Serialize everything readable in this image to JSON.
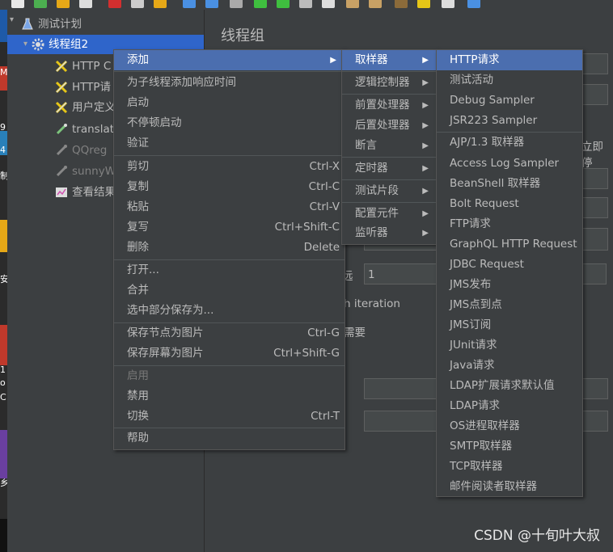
{
  "toolbar": {
    "icons": [
      {
        "name": "new-icon",
        "color": "#e8e8e8"
      },
      {
        "name": "templates-icon",
        "color": "#4caf50"
      },
      {
        "name": "open-icon",
        "color": "#e6a817"
      },
      {
        "name": "save-icon",
        "color": "#dddddd"
      },
      {
        "name": "cut-icon",
        "color": "#d32f2f"
      },
      {
        "name": "copy-icon",
        "color": "#cccccc"
      },
      {
        "name": "paste-icon",
        "color": "#e6a817"
      },
      {
        "name": "expand-icon",
        "color": "#4a90e2"
      },
      {
        "name": "collapse-icon",
        "color": "#4a90e2"
      },
      {
        "name": "toggle-icon",
        "color": "#aaaaaa"
      },
      {
        "name": "start-icon",
        "color": "#3fbf3f"
      },
      {
        "name": "start-no-pause-icon",
        "color": "#3fbf3f"
      },
      {
        "name": "stop-icon",
        "color": "#bbbbbb"
      },
      {
        "name": "shutdown-icon",
        "color": "#dddddd"
      },
      {
        "name": "clear-icon",
        "color": "#c8a165"
      },
      {
        "name": "clear-all-icon",
        "color": "#c8a165"
      },
      {
        "name": "search-icon",
        "color": "#8b6b3a"
      },
      {
        "name": "reset-search-icon",
        "color": "#e6c617"
      },
      {
        "name": "function-helper-icon",
        "color": "#dddddd"
      },
      {
        "name": "help-icon",
        "color": "#4a90e2"
      }
    ]
  },
  "desktop_strip": {
    "chars": [
      "M",
      "9",
      "4",
      "制",
      "安",
      "1",
      "o",
      "C",
      "乡"
    ]
  },
  "tree": {
    "items": [
      {
        "label": "测试计划",
        "icon": "test-plan-icon"
      },
      {
        "label": "线程组2",
        "icon": "gear-icon"
      },
      {
        "label": "HTTP C",
        "icon": "http-sampler-icon"
      },
      {
        "label": "HTTP请",
        "icon": "http-sampler-icon"
      },
      {
        "label": "用户定义",
        "icon": "user-defined-icon"
      },
      {
        "label": "translat",
        "icon": "pipette-icon"
      },
      {
        "label": "QQreg",
        "icon": "pipette-icon"
      },
      {
        "label": "sunnyW",
        "icon": "pipette-icon"
      },
      {
        "label": "查看结果",
        "icon": "results-tree-icon"
      }
    ]
  },
  "right_panel": {
    "title": "线程组",
    "partial_text_1": "立即停",
    "partial_text_2": "远",
    "loop_value": "1",
    "partial_text_3": "h iteration",
    "partial_text_4": "需要"
  },
  "context_menu": {
    "items": [
      {
        "label": "添加",
        "shortcut": "",
        "submenu": true
      },
      {
        "label": "为子线程添加响应时间",
        "shortcut": ""
      },
      {
        "label": "启动",
        "shortcut": ""
      },
      {
        "label": "不停顿启动",
        "shortcut": ""
      },
      {
        "label": "验证",
        "shortcut": ""
      },
      {
        "label": "剪切",
        "shortcut": "Ctrl-X"
      },
      {
        "label": "复制",
        "shortcut": "Ctrl-C"
      },
      {
        "label": "粘贴",
        "shortcut": "Ctrl-V"
      },
      {
        "label": "复写",
        "shortcut": "Ctrl+Shift-C"
      },
      {
        "label": "删除",
        "shortcut": "Delete"
      },
      {
        "label": "打开...",
        "shortcut": ""
      },
      {
        "label": "合并",
        "shortcut": ""
      },
      {
        "label": "选中部分保存为...",
        "shortcut": ""
      },
      {
        "label": "保存节点为图片",
        "shortcut": "Ctrl-G"
      },
      {
        "label": "保存屏幕为图片",
        "shortcut": "Ctrl+Shift-G"
      },
      {
        "label": "启用",
        "shortcut": ""
      },
      {
        "label": "禁用",
        "shortcut": ""
      },
      {
        "label": "切换",
        "shortcut": "Ctrl-T"
      },
      {
        "label": "帮助",
        "shortcut": ""
      }
    ]
  },
  "add_submenu": {
    "items": [
      {
        "label": "取样器"
      },
      {
        "label": "逻辑控制器"
      },
      {
        "label": "前置处理器"
      },
      {
        "label": "后置处理器"
      },
      {
        "label": "断言"
      },
      {
        "label": "定时器"
      },
      {
        "label": "测试片段"
      },
      {
        "label": "配置元件"
      },
      {
        "label": "监听器"
      }
    ]
  },
  "sampler_submenu": {
    "items": [
      {
        "label": "HTTP请求"
      },
      {
        "label": "测试活动"
      },
      {
        "label": "Debug Sampler"
      },
      {
        "label": "JSR223 Sampler"
      },
      {
        "label": "AJP/1.3 取样器"
      },
      {
        "label": "Access Log Sampler"
      },
      {
        "label": "BeanShell 取样器"
      },
      {
        "label": "Bolt Request"
      },
      {
        "label": "FTP请求"
      },
      {
        "label": "GraphQL HTTP Request"
      },
      {
        "label": "JDBC Request"
      },
      {
        "label": "JMS发布"
      },
      {
        "label": "JMS点到点"
      },
      {
        "label": "JMS订阅"
      },
      {
        "label": "JUnit请求"
      },
      {
        "label": "Java请求"
      },
      {
        "label": "LDAP扩展请求默认值"
      },
      {
        "label": "LDAP请求"
      },
      {
        "label": "OS进程取样器"
      },
      {
        "label": "SMTP取样器"
      },
      {
        "label": "TCP取样器"
      },
      {
        "label": "邮件阅读者取样器"
      }
    ]
  },
  "watermark": "CSDN @十旬叶大叔"
}
